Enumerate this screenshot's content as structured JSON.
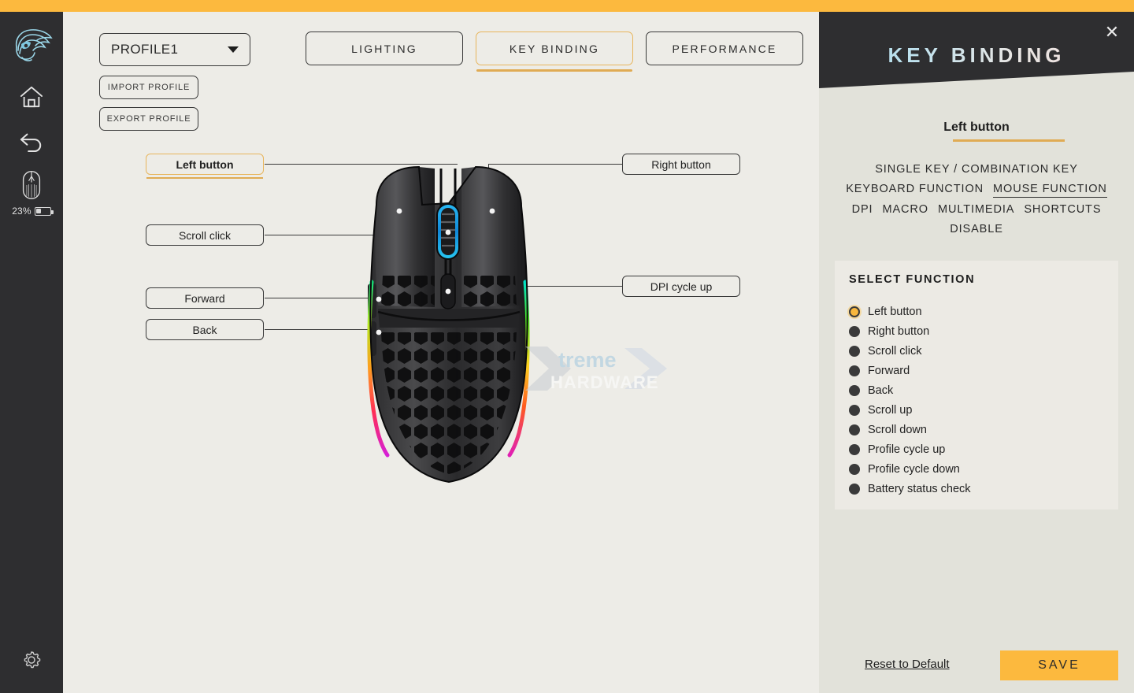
{
  "theme": {
    "accent": "#fcb93e",
    "accent_border": "#e8b55c",
    "dark": "#2e2e30",
    "canvas": "#edece7",
    "panel_bg": "#e2e2da",
    "card_bg": "#eceae4",
    "text": "#222222"
  },
  "sidebar": {
    "logo": "glorious-logo-icon",
    "items": [
      {
        "name": "home-icon",
        "label": "Home"
      },
      {
        "name": "back-icon",
        "label": "Back"
      },
      {
        "name": "mouse-device-icon",
        "label": "Mouse"
      }
    ],
    "battery": {
      "percent": "23%",
      "icon": "battery-icon"
    },
    "settings": {
      "name": "gear-icon",
      "label": "Settings"
    }
  },
  "toolbar": {
    "profile": {
      "value": "PROFILE1",
      "caret": "chevron-down-icon"
    },
    "import_label": "IMPORT PROFILE",
    "export_label": "EXPORT PROFILE"
  },
  "tabs": [
    {
      "label": "LIGHTING",
      "active": false
    },
    {
      "label": "KEY BINDING",
      "active": true
    },
    {
      "label": "PERFORMANCE",
      "active": false
    }
  ],
  "diagram": {
    "device": "glorious-model-o-mouse",
    "watermark": {
      "line1": "Xtreme",
      "line2": "HARDWARE"
    },
    "callouts": [
      {
        "label": "Left button",
        "side": "left",
        "active": true
      },
      {
        "label": "Scroll click",
        "side": "left",
        "active": false
      },
      {
        "label": "Forward",
        "side": "left",
        "active": false
      },
      {
        "label": "Back",
        "side": "left",
        "active": false
      },
      {
        "label": "Right button",
        "side": "right",
        "active": false
      },
      {
        "label": "DPI cycle up",
        "side": "right",
        "active": false
      }
    ]
  },
  "panel": {
    "title": "KEY BINDING",
    "close": "close-icon",
    "subtitle": "Left button",
    "categories": [
      {
        "label": "SINGLE KEY / COMBINATION KEY",
        "active": false,
        "row": 0
      },
      {
        "label": "KEYBOARD FUNCTION",
        "active": false,
        "row": 1
      },
      {
        "label": "MOUSE FUNCTION",
        "active": true,
        "row": 1
      },
      {
        "label": "DPI",
        "active": false,
        "row": 2
      },
      {
        "label": "MACRO",
        "active": false,
        "row": 2
      },
      {
        "label": "MULTIMEDIA",
        "active": false,
        "row": 2
      },
      {
        "label": "SHORTCUTS",
        "active": false,
        "row": 2
      },
      {
        "label": "DISABLE",
        "active": false,
        "row": 3
      }
    ],
    "select_function": {
      "title": "SELECT FUNCTION",
      "options": [
        {
          "label": "Left button",
          "selected": true
        },
        {
          "label": "Right button",
          "selected": false
        },
        {
          "label": "Scroll click",
          "selected": false
        },
        {
          "label": "Forward",
          "selected": false
        },
        {
          "label": "Back",
          "selected": false
        },
        {
          "label": "Scroll up",
          "selected": false
        },
        {
          "label": "Scroll down",
          "selected": false
        },
        {
          "label": "Profile cycle up",
          "selected": false
        },
        {
          "label": "Profile cycle down",
          "selected": false
        },
        {
          "label": "Battery status check",
          "selected": false
        }
      ]
    },
    "reset_label": "Reset to Default",
    "save_label": "SAVE"
  }
}
